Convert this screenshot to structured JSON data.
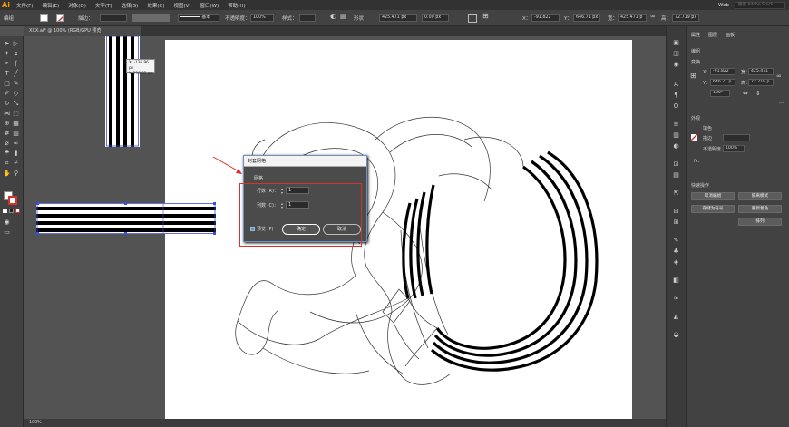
{
  "app": {
    "logo": "Ai",
    "workspace": "Web",
    "search_placeholder": "搜索 Adobe Stock"
  },
  "menu": [
    "文件(F)",
    "编辑(E)",
    "对象(O)",
    "文字(T)",
    "选择(S)",
    "效果(C)",
    "视图(V)",
    "窗口(W)",
    "帮助(H)"
  ],
  "control_bar": {
    "group_label": "编组",
    "stroke_label": "描边：",
    "style_name": "基本",
    "opacity_label": "不透明度：",
    "opacity_value": "100%",
    "style_label": "样式：",
    "shape_label": "形状：",
    "shape_width": "425.471 px",
    "shape_height": "0.00 px",
    "x_label": "X：",
    "x_value": "-91.822",
    "y_label": "Y：",
    "y_value": "646.71 px",
    "w_label": "宽：",
    "w_value": "425.471 p",
    "h_label": "高：",
    "h_value": "72.719 px"
  },
  "document_tab": "XXX.ai* @ 100% (RGB/GPU 预览)",
  "tooltip": {
    "x_line": "X: -136.96 px",
    "y_line": "Y: 299.82 px"
  },
  "status_bar": {
    "zoom": "100%"
  },
  "dialog": {
    "title": "封套网格",
    "group": "网格",
    "rows_label": "行数 (R)：",
    "rows_value": "1",
    "cols_label": "列数 (C)：",
    "cols_value": "1",
    "preview_label": "预览 (P)",
    "ok_label": "确定",
    "cancel_label": "取消"
  },
  "properties_panel": {
    "tabs": [
      "属性",
      "图层",
      "画板"
    ],
    "section_group": "编组",
    "section_transform": "变换",
    "x_label": "X：",
    "x_value": "-91.822",
    "y_label": "Y：",
    "y_value": "646.71 p",
    "w_label": "宽：",
    "w_value": "425.471",
    "h_label": "高：",
    "h_value": "72.719 p",
    "angle_value": "180°",
    "section_appearance": "外观",
    "fill_label": "填色",
    "stroke_label": "描边",
    "opacity_label": "不透明度",
    "opacity_value": "100%",
    "fx_label": "fx.",
    "section_quick_actions": "快速操作",
    "buttons": [
      "取消编组",
      "隔离模式",
      "存储为符号",
      "重新着色",
      "排列"
    ]
  },
  "colors": {
    "accent_red": "#d8322f",
    "dialog_border": "#6e8fc2",
    "app_dark": "#323232",
    "panel": "#424242"
  }
}
